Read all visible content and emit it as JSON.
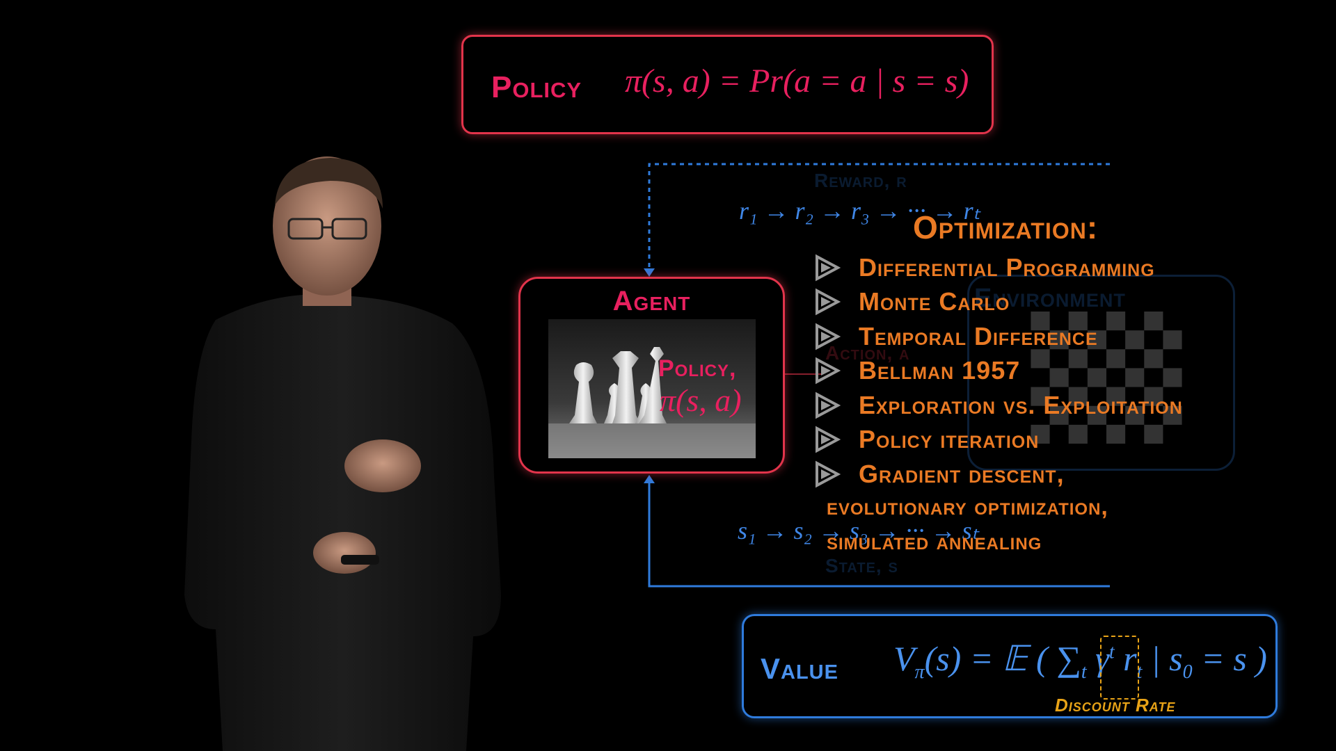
{
  "policy_box": {
    "title": "Policy",
    "formula": "π(s, a) = Pr(a = a | s = s)"
  },
  "agent": {
    "title": "Agent",
    "policy_label": "Policy,",
    "policy_formula": "π(s, a)"
  },
  "environment_faded": {
    "title": "Environment",
    "reward_label": "Reward, r",
    "action_label": "Action, a",
    "state_label": "State, s"
  },
  "sequences": {
    "reward": "r₁ → r₂ → r₃ → ··· → rₜ",
    "state": "s₁ → s₂ → s₃ → ··· → sₜ"
  },
  "optimization": {
    "title": "Optimization:",
    "items": [
      "Differential Programming",
      "Monte Carlo",
      "Temporal Difference",
      "Bellman 1957",
      "Exploration vs. Exploitation",
      "Policy iteration",
      "Gradient descent,"
    ],
    "continuation": [
      "evolutionary optimization,",
      "simulated annealing"
    ]
  },
  "value_box": {
    "title": "Value",
    "formula_lhs": "V",
    "formula_lhs_sub": "π",
    "formula_rest": "(s) = 𝔼 ( ∑",
    "formula_sum_sub": "t",
    "formula_gamma": "γ",
    "formula_gamma_sup": "t",
    "formula_r": "r",
    "formula_r_sub": "t",
    "formula_cond": "| s",
    "formula_s_sub": "0",
    "formula_end": "= s )",
    "discount_label": "Discount Rate"
  },
  "colors": {
    "policy_red": "#e8205f",
    "value_blue": "#4a92ee",
    "optimization_orange": "#ea7a24",
    "discount_yellow": "#e8a317"
  }
}
